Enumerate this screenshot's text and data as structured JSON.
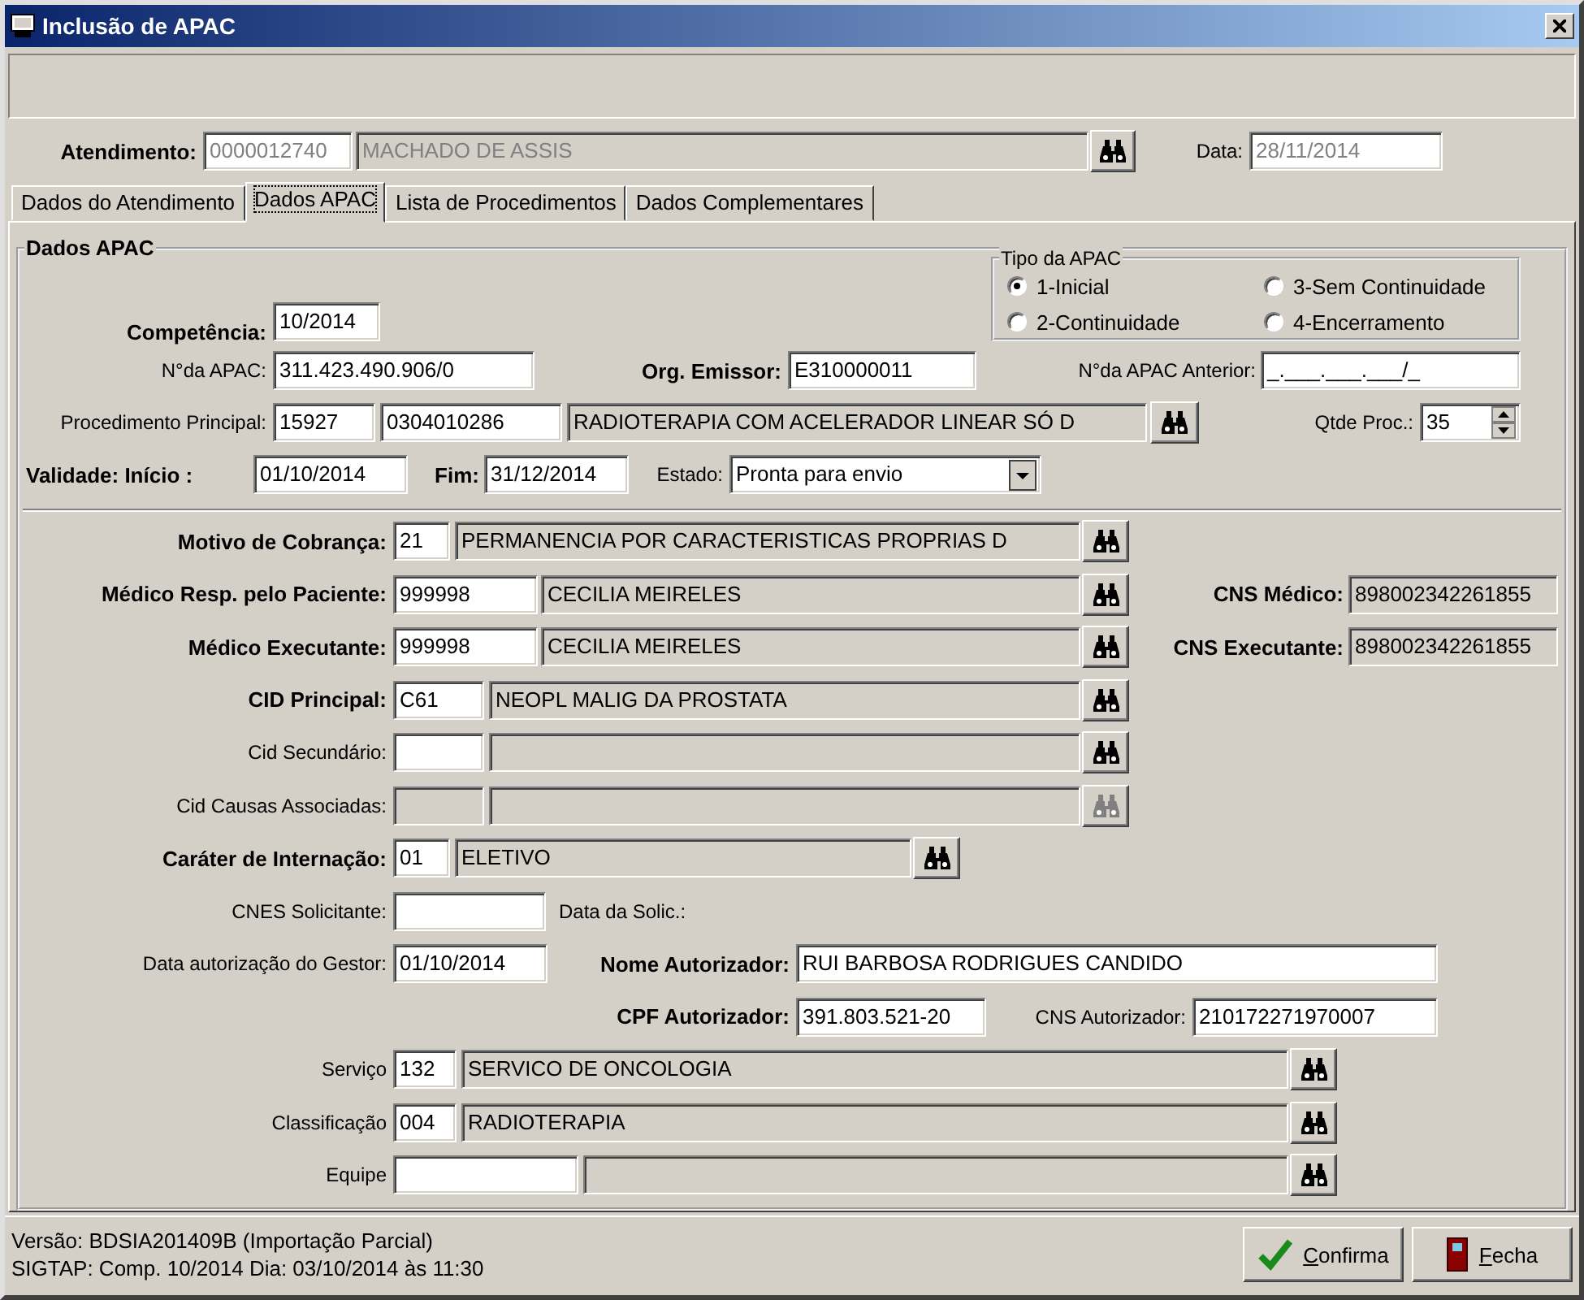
{
  "window": {
    "title": "Inclusão de APAC"
  },
  "header": {
    "items": [
      {
        "kind": "strong_label",
        "text": "Atendimento:"
      },
      {
        "kind": "field",
        "value": "0000012740",
        "disabled": true
      },
      {
        "kind": "readonly",
        "value": "MACHADO DE ASSIS",
        "disabled": true
      },
      {
        "kind": "lookup",
        "disabled": false
      },
      {
        "kind": "label",
        "text": "Data:"
      },
      {
        "kind": "field",
        "value": "28/11/2014",
        "disabled": true
      }
    ]
  },
  "tabs": [
    {
      "label": "Dados do Atendimento",
      "selected": false
    },
    {
      "label": "Dados APAC",
      "selected": true
    },
    {
      "label": "Lista de Procedimentos",
      "selected": false
    },
    {
      "label": "Dados Complementares",
      "selected": false
    }
  ],
  "form": {
    "title": "Dados APAC",
    "top_rows": [
      {
        "items": [
          {
            "kind": "strong_label",
            "text": "Competência:"
          },
          {
            "kind": "field",
            "value": "10/2014"
          },
          {
            "kind": "radio_group",
            "title": "Tipo da APAC",
            "options": [
              {
                "label": "1-Inicial",
                "selected": true
              },
              {
                "label": "3-Sem Continuidade",
                "selected": false
              },
              {
                "label": "2-Continuidade",
                "selected": false
              },
              {
                "label": "4-Encerramento",
                "selected": false
              }
            ]
          }
        ]
      },
      {
        "items": [
          {
            "kind": "label",
            "text": "N°da APAC:"
          },
          {
            "kind": "field",
            "value": "311.423.490.906/0"
          },
          {
            "kind": "strong_label",
            "text": "Org. Emissor:"
          },
          {
            "kind": "field",
            "value": "E310000011"
          },
          {
            "kind": "label",
            "text": "N°da APAC Anterior:"
          },
          {
            "kind": "field",
            "value": "_.___.___.___/_"
          }
        ]
      },
      {
        "items": [
          {
            "kind": "label",
            "text": "Procedimento Principal:"
          },
          {
            "kind": "field",
            "value": "15927"
          },
          {
            "kind": "field",
            "value": "0304010286"
          },
          {
            "kind": "readonly",
            "value": "RADIOTERAPIA COM ACELERADOR LINEAR SÓ D"
          },
          {
            "kind": "lookup",
            "disabled": false
          },
          {
            "kind": "label",
            "text": "Qtde Proc.:"
          },
          {
            "kind": "spin",
            "value": "35"
          }
        ]
      },
      {
        "items": [
          {
            "kind": "strong_label",
            "text": "Validade: Início :"
          },
          {
            "kind": "field",
            "value": "01/10/2014"
          },
          {
            "kind": "strong_label",
            "text": "Fim:"
          },
          {
            "kind": "field",
            "value": "31/12/2014"
          },
          {
            "kind": "label",
            "text": "Estado:"
          },
          {
            "kind": "select",
            "value": "Pronta para envio"
          }
        ]
      }
    ],
    "bottom_rows": [
      {
        "items": [
          {
            "kind": "strong_label",
            "text": "Motivo de Cobrança:"
          },
          {
            "kind": "field",
            "value": "21"
          },
          {
            "kind": "readonly",
            "value": "PERMANENCIA POR CARACTERISTICAS PROPRIAS D"
          },
          {
            "kind": "lookup",
            "disabled": false
          }
        ]
      },
      {
        "items": [
          {
            "kind": "strong_label",
            "text": "Médico Resp. pelo Paciente:"
          },
          {
            "kind": "field",
            "value": "999998"
          },
          {
            "kind": "readonly",
            "value": "CECILIA MEIRELES"
          },
          {
            "kind": "lookup",
            "disabled": false
          },
          {
            "kind": "strong_label",
            "text": "CNS Médico:"
          },
          {
            "kind": "readonly",
            "value": "898002342261855"
          }
        ]
      },
      {
        "items": [
          {
            "kind": "strong_label",
            "text": "Médico Executante:"
          },
          {
            "kind": "field",
            "value": "999998"
          },
          {
            "kind": "readonly",
            "value": "CECILIA MEIRELES"
          },
          {
            "kind": "lookup",
            "disabled": false
          },
          {
            "kind": "strong_label",
            "text": "CNS Executante:"
          },
          {
            "kind": "readonly",
            "value": "898002342261855"
          }
        ]
      },
      {
        "items": [
          {
            "kind": "strong_label",
            "text": "CID Principal:"
          },
          {
            "kind": "field",
            "value": "C61"
          },
          {
            "kind": "readonly",
            "value": "NEOPL MALIG DA PROSTATA"
          },
          {
            "kind": "lookup",
            "disabled": false
          }
        ]
      },
      {
        "items": [
          {
            "kind": "label",
            "text": "Cid Secundário:"
          },
          {
            "kind": "field"
          },
          {
            "kind": "readonly"
          },
          {
            "kind": "lookup",
            "disabled": false
          }
        ]
      },
      {
        "items": [
          {
            "kind": "label",
            "text": "Cid Causas Associadas:"
          },
          {
            "kind": "readonly"
          },
          {
            "kind": "readonly"
          },
          {
            "kind": "lookup",
            "disabled": true
          }
        ]
      },
      {
        "items": [
          {
            "kind": "strong_label",
            "text": "Caráter de Internação:"
          },
          {
            "kind": "field",
            "value": "01"
          },
          {
            "kind": "readonly",
            "value": "ELETIVO"
          },
          {
            "kind": "lookup",
            "disabled": false
          }
        ]
      },
      {
        "items": [
          {
            "kind": "label",
            "text": "CNES Solicitante:"
          },
          {
            "kind": "field"
          },
          {
            "kind": "label",
            "text": "Data da Solic.:"
          }
        ]
      },
      {
        "items": [
          {
            "kind": "label",
            "text": "Data autorização do Gestor:"
          },
          {
            "kind": "field",
            "value": "01/10/2014"
          },
          {
            "kind": "strong_label",
            "text": "Nome Autorizador:"
          },
          {
            "kind": "field",
            "value": "RUI BARBOSA RODRIGUES CANDIDO"
          }
        ]
      },
      {
        "items": [
          {
            "kind": "strong_label",
            "text": "CPF Autorizador:"
          },
          {
            "kind": "field",
            "value": "391.803.521-20"
          },
          {
            "kind": "label",
            "text": "CNS Autorizador:"
          },
          {
            "kind": "field",
            "value": "210172271970007"
          }
        ]
      },
      {
        "items": [
          {
            "kind": "label",
            "text": "Serviço"
          },
          {
            "kind": "field",
            "value": "132"
          },
          {
            "kind": "readonly",
            "value": "SERVICO DE ONCOLOGIA"
          },
          {
            "kind": "lookup",
            "disabled": false
          }
        ]
      },
      {
        "items": [
          {
            "kind": "label",
            "text": "Classificação"
          },
          {
            "kind": "field",
            "value": "004"
          },
          {
            "kind": "readonly",
            "value": "RADIOTERAPIA"
          },
          {
            "kind": "lookup",
            "disabled": false
          }
        ]
      },
      {
        "items": [
          {
            "kind": "label",
            "text": "Equipe"
          },
          {
            "kind": "field"
          },
          {
            "kind": "readonly"
          },
          {
            "kind": "lookup",
            "disabled": false
          }
        ]
      }
    ]
  },
  "status_bar": {
    "lines": [
      "Versão: BDSIA201409B (Importação Parcial)",
      "SIGTAP: Comp. 10/2014 Dia: 03/10/2014 às 11:30"
    ]
  },
  "buttons": [
    {
      "kind": "confirm",
      "label": "Confirma"
    },
    {
      "kind": "close",
      "label": "Fecha"
    }
  ]
}
